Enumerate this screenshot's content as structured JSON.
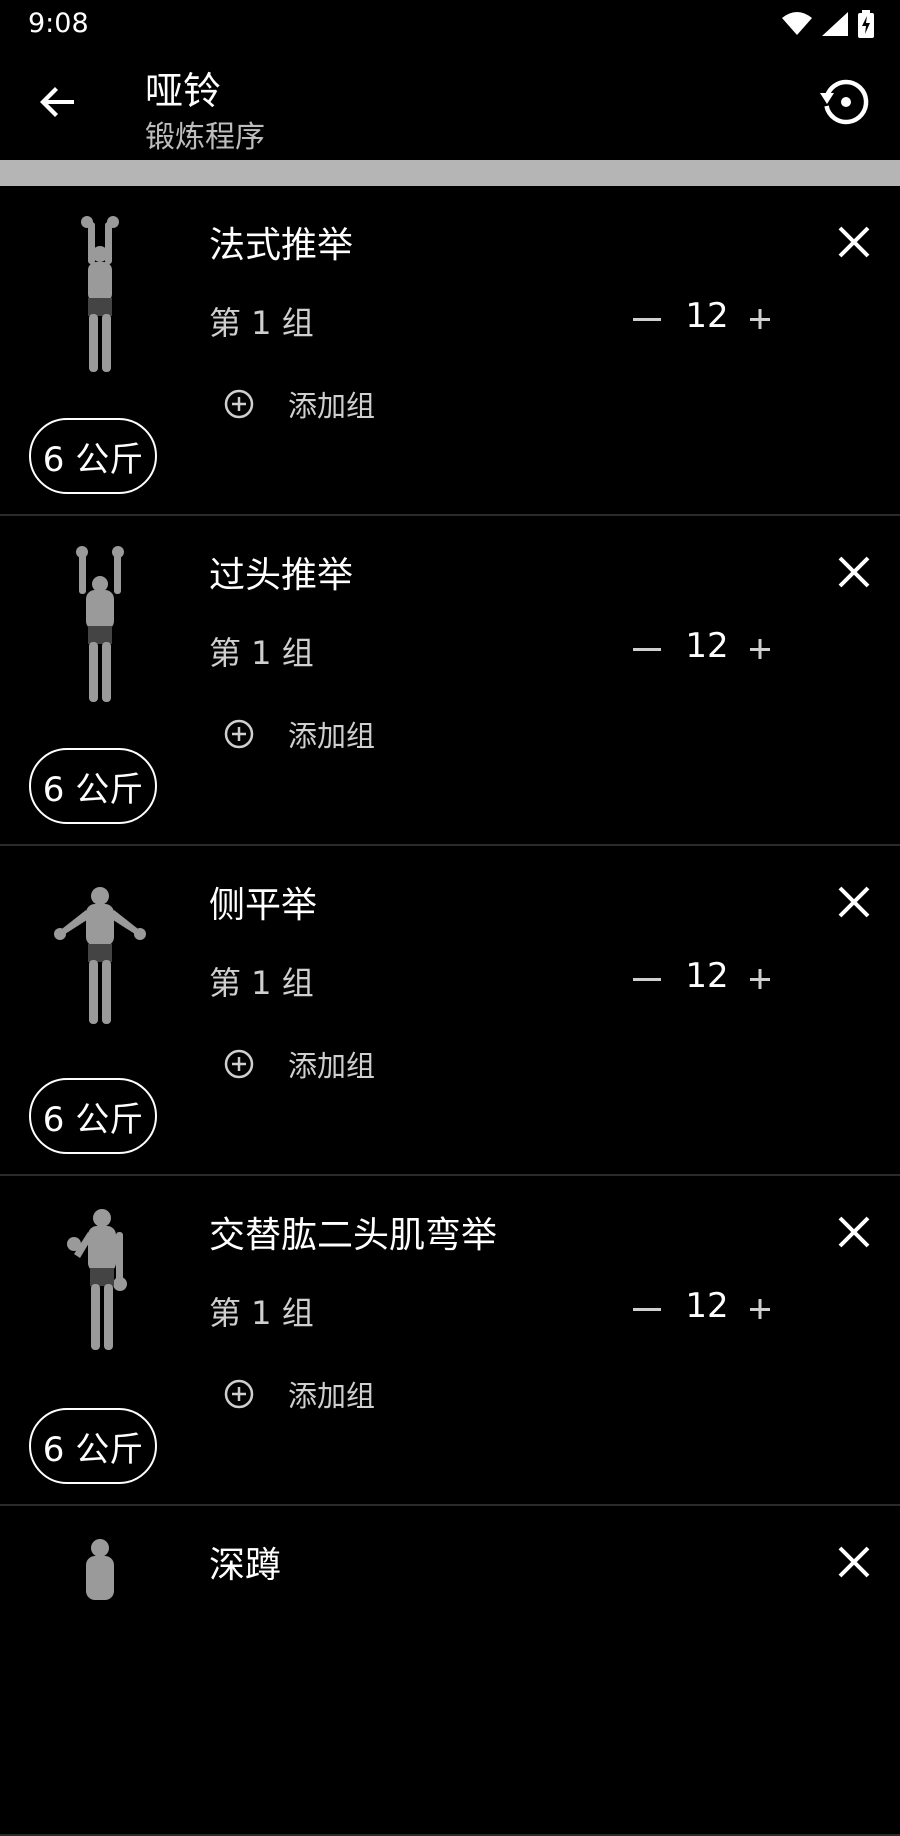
{
  "status": {
    "time": "9:08"
  },
  "header": {
    "title": "哑铃",
    "subtitle": "锻炼程序"
  },
  "exercises": [
    {
      "name": "法式推举",
      "set_label": "第 1 组",
      "reps": "12",
      "add_set": "添加组",
      "weight": "6 公斤"
    },
    {
      "name": "过头推举",
      "set_label": "第 1 组",
      "reps": "12",
      "add_set": "添加组",
      "weight": "6 公斤"
    },
    {
      "name": "侧平举",
      "set_label": "第 1 组",
      "reps": "12",
      "add_set": "添加组",
      "weight": "6 公斤"
    },
    {
      "name": "交替肱二头肌弯举",
      "set_label": "第 1 组",
      "reps": "12",
      "add_set": "添加组",
      "weight": "6 公斤"
    },
    {
      "name": "深蹲"
    }
  ]
}
